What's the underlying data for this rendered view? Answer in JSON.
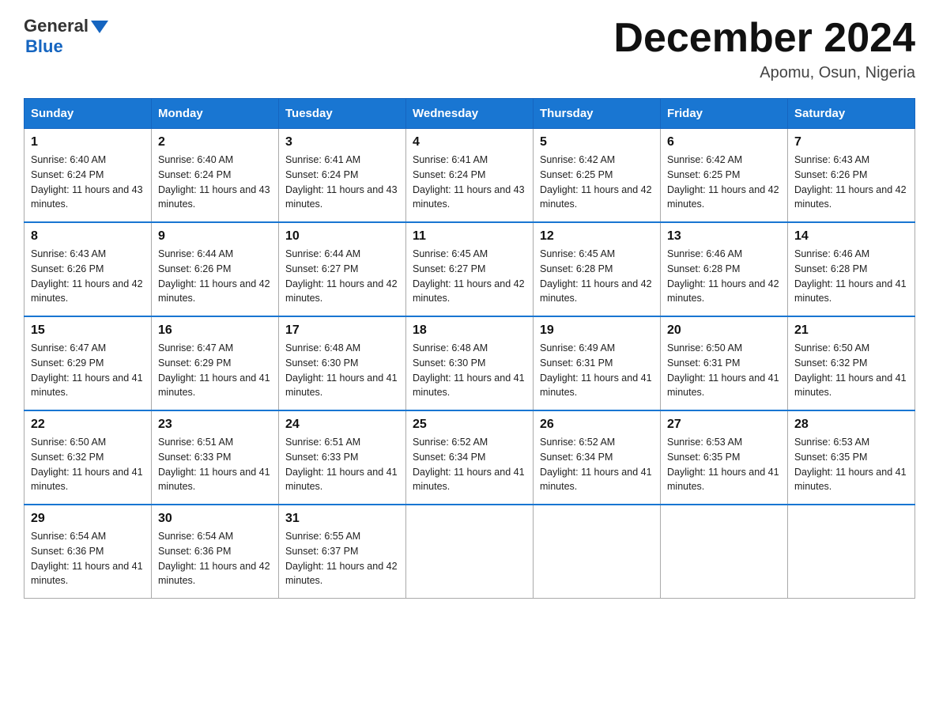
{
  "header": {
    "logo_general": "General",
    "logo_blue": "Blue",
    "month_title": "December 2024",
    "location": "Apomu, Osun, Nigeria"
  },
  "days_of_week": [
    "Sunday",
    "Monday",
    "Tuesday",
    "Wednesday",
    "Thursday",
    "Friday",
    "Saturday"
  ],
  "weeks": [
    [
      {
        "day": "1",
        "sunrise": "6:40 AM",
        "sunset": "6:24 PM",
        "daylight": "11 hours and 43 minutes."
      },
      {
        "day": "2",
        "sunrise": "6:40 AM",
        "sunset": "6:24 PM",
        "daylight": "11 hours and 43 minutes."
      },
      {
        "day": "3",
        "sunrise": "6:41 AM",
        "sunset": "6:24 PM",
        "daylight": "11 hours and 43 minutes."
      },
      {
        "day": "4",
        "sunrise": "6:41 AM",
        "sunset": "6:24 PM",
        "daylight": "11 hours and 43 minutes."
      },
      {
        "day": "5",
        "sunrise": "6:42 AM",
        "sunset": "6:25 PM",
        "daylight": "11 hours and 42 minutes."
      },
      {
        "day": "6",
        "sunrise": "6:42 AM",
        "sunset": "6:25 PM",
        "daylight": "11 hours and 42 minutes."
      },
      {
        "day": "7",
        "sunrise": "6:43 AM",
        "sunset": "6:26 PM",
        "daylight": "11 hours and 42 minutes."
      }
    ],
    [
      {
        "day": "8",
        "sunrise": "6:43 AM",
        "sunset": "6:26 PM",
        "daylight": "11 hours and 42 minutes."
      },
      {
        "day": "9",
        "sunrise": "6:44 AM",
        "sunset": "6:26 PM",
        "daylight": "11 hours and 42 minutes."
      },
      {
        "day": "10",
        "sunrise": "6:44 AM",
        "sunset": "6:27 PM",
        "daylight": "11 hours and 42 minutes."
      },
      {
        "day": "11",
        "sunrise": "6:45 AM",
        "sunset": "6:27 PM",
        "daylight": "11 hours and 42 minutes."
      },
      {
        "day": "12",
        "sunrise": "6:45 AM",
        "sunset": "6:28 PM",
        "daylight": "11 hours and 42 minutes."
      },
      {
        "day": "13",
        "sunrise": "6:46 AM",
        "sunset": "6:28 PM",
        "daylight": "11 hours and 42 minutes."
      },
      {
        "day": "14",
        "sunrise": "6:46 AM",
        "sunset": "6:28 PM",
        "daylight": "11 hours and 41 minutes."
      }
    ],
    [
      {
        "day": "15",
        "sunrise": "6:47 AM",
        "sunset": "6:29 PM",
        "daylight": "11 hours and 41 minutes."
      },
      {
        "day": "16",
        "sunrise": "6:47 AM",
        "sunset": "6:29 PM",
        "daylight": "11 hours and 41 minutes."
      },
      {
        "day": "17",
        "sunrise": "6:48 AM",
        "sunset": "6:30 PM",
        "daylight": "11 hours and 41 minutes."
      },
      {
        "day": "18",
        "sunrise": "6:48 AM",
        "sunset": "6:30 PM",
        "daylight": "11 hours and 41 minutes."
      },
      {
        "day": "19",
        "sunrise": "6:49 AM",
        "sunset": "6:31 PM",
        "daylight": "11 hours and 41 minutes."
      },
      {
        "day": "20",
        "sunrise": "6:50 AM",
        "sunset": "6:31 PM",
        "daylight": "11 hours and 41 minutes."
      },
      {
        "day": "21",
        "sunrise": "6:50 AM",
        "sunset": "6:32 PM",
        "daylight": "11 hours and 41 minutes."
      }
    ],
    [
      {
        "day": "22",
        "sunrise": "6:50 AM",
        "sunset": "6:32 PM",
        "daylight": "11 hours and 41 minutes."
      },
      {
        "day": "23",
        "sunrise": "6:51 AM",
        "sunset": "6:33 PM",
        "daylight": "11 hours and 41 minutes."
      },
      {
        "day": "24",
        "sunrise": "6:51 AM",
        "sunset": "6:33 PM",
        "daylight": "11 hours and 41 minutes."
      },
      {
        "day": "25",
        "sunrise": "6:52 AM",
        "sunset": "6:34 PM",
        "daylight": "11 hours and 41 minutes."
      },
      {
        "day": "26",
        "sunrise": "6:52 AM",
        "sunset": "6:34 PM",
        "daylight": "11 hours and 41 minutes."
      },
      {
        "day": "27",
        "sunrise": "6:53 AM",
        "sunset": "6:35 PM",
        "daylight": "11 hours and 41 minutes."
      },
      {
        "day": "28",
        "sunrise": "6:53 AM",
        "sunset": "6:35 PM",
        "daylight": "11 hours and 41 minutes."
      }
    ],
    [
      {
        "day": "29",
        "sunrise": "6:54 AM",
        "sunset": "6:36 PM",
        "daylight": "11 hours and 41 minutes."
      },
      {
        "day": "30",
        "sunrise": "6:54 AM",
        "sunset": "6:36 PM",
        "daylight": "11 hours and 42 minutes."
      },
      {
        "day": "31",
        "sunrise": "6:55 AM",
        "sunset": "6:37 PM",
        "daylight": "11 hours and 42 minutes."
      },
      null,
      null,
      null,
      null
    ]
  ],
  "sunrise_label": "Sunrise:",
  "sunset_label": "Sunset:",
  "daylight_label": "Daylight:"
}
